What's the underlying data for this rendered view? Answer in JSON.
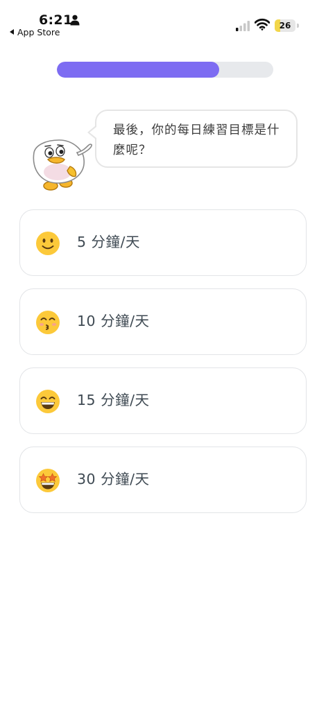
{
  "status_bar": {
    "time": "6:21",
    "back_label": "App Store",
    "battery_level": "26"
  },
  "progress": {
    "fraction": 0.75
  },
  "prompt": {
    "text": "最後，你的每日練習目標是什麼呢？"
  },
  "options": [
    {
      "label": "5 分鐘/天",
      "emoji": "slightly-smiling-face"
    },
    {
      "label": "10 分鐘/天",
      "emoji": "kissing-face"
    },
    {
      "label": "15 分鐘/天",
      "emoji": "grinning-face"
    },
    {
      "label": "30 分鐘/天",
      "emoji": "star-struck-face"
    }
  ],
  "colors": {
    "accent": "#7d6cf2",
    "track": "#e7e9ec",
    "emoji_yellow": "#fcc93a",
    "text": "#3f4a53"
  }
}
